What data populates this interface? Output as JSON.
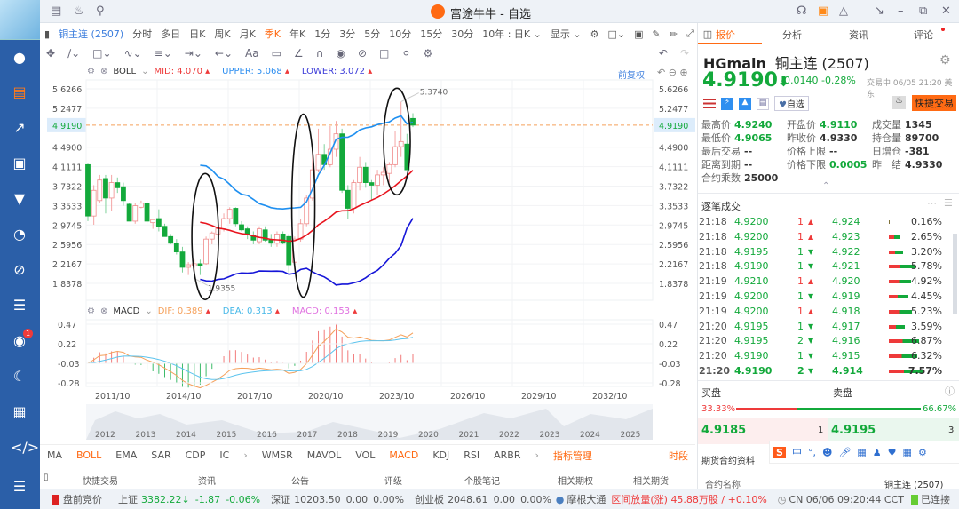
{
  "window": {
    "title": "富途牛牛 - 自选"
  },
  "toolbar": {
    "symbol": "铜主连 (2507)",
    "periods": [
      "分时",
      "多日",
      "日K",
      "周K",
      "月K",
      "季K",
      "年K",
      "1分",
      "3分",
      "5分",
      "10分",
      "15分",
      "30分"
    ],
    "active_period": "季K",
    "range": "10年 : 日K",
    "display": "显示"
  },
  "boll": {
    "name": "BOLL",
    "mid_label": "MID:",
    "mid": "4.070",
    "upper_label": "UPPER:",
    "upper": "5.068",
    "lower_label": "LOWER:",
    "lower": "3.072",
    "adjust": "前复权"
  },
  "macd": {
    "name": "MACD",
    "dif_label": "DIF:",
    "dif": "0.389",
    "dea_label": "DEA:",
    "dea": "0.313",
    "macd_label": "MACD:",
    "macd": "0.153"
  },
  "chart_data": {
    "type": "candlestick",
    "price_axis": [
      "5.6266",
      "5.2477",
      "4.9190",
      "4.4900",
      "4.1111",
      "3.7322",
      "3.3533",
      "2.9745",
      "2.5956",
      "2.2167",
      "1.8378"
    ],
    "price_range": [
      1.8378,
      5.6266
    ],
    "current_price": "4.9190",
    "high_label": "5.3740",
    "low_label": "1.9355",
    "candles": [
      [
        4.15,
        4.17,
        3.05,
        3.15
      ],
      [
        3.15,
        3.75,
        2.98,
        3.65
      ],
      [
        3.45,
        3.95,
        3.4,
        3.85
      ],
      [
        3.88,
        3.95,
        3.2,
        3.5
      ],
      [
        3.5,
        3.95,
        3.25,
        3.8
      ],
      [
        3.8,
        3.9,
        3.6,
        3.7
      ],
      [
        3.72,
        3.8,
        3.35,
        3.45
      ],
      [
        3.38,
        3.4,
        3.05,
        3.05
      ],
      [
        3.05,
        3.4,
        3.0,
        3.35
      ],
      [
        3.32,
        3.45,
        3.3,
        3.4
      ],
      [
        3.4,
        3.45,
        3.0,
        3.05
      ],
      [
        3.02,
        3.1,
        2.9,
        3.08
      ],
      [
        3.1,
        3.28,
        2.85,
        2.95
      ],
      [
        2.95,
        3.0,
        2.75,
        2.75
      ],
      [
        2.75,
        2.8,
        2.6,
        2.62
      ],
      [
        2.62,
        2.7,
        2.4,
        2.45
      ],
      [
        2.45,
        2.55,
        2.05,
        2.15
      ],
      [
        2.15,
        2.25,
        2.0,
        2.2
      ],
      [
        2.18,
        2.3,
        1.9355,
        2.22
      ],
      [
        2.22,
        2.3,
        2.0,
        2.18
      ],
      [
        2.22,
        2.75,
        2.2,
        2.7
      ],
      [
        2.7,
        2.85,
        2.6,
        2.82
      ],
      [
        2.8,
        2.9,
        2.7,
        2.9
      ],
      [
        2.9,
        3.2,
        2.85,
        3.1
      ],
      [
        3.1,
        3.32,
        3.0,
        3.28
      ],
      [
        3.3,
        3.32,
        2.95,
        3.0
      ],
      [
        2.98,
        3.05,
        2.85,
        2.88
      ],
      [
        2.9,
        2.95,
        2.7,
        2.78
      ],
      [
        2.78,
        2.85,
        2.6,
        2.68
      ],
      [
        2.65,
        2.95,
        2.6,
        2.9
      ],
      [
        2.88,
        2.95,
        2.65,
        2.68
      ],
      [
        2.68,
        2.8,
        2.55,
        2.62
      ],
      [
        2.62,
        2.85,
        2.55,
        2.8
      ],
      [
        2.8,
        2.85,
        2.6,
        2.62
      ],
      [
        2.75,
        2.8,
        2.05,
        2.2
      ],
      [
        2.25,
        2.75,
        2.15,
        2.7
      ],
      [
        2.7,
        3.1,
        2.65,
        3.0
      ],
      [
        3.0,
        3.55,
        2.95,
        3.5
      ],
      [
        3.5,
        4.45,
        3.45,
        4.05
      ],
      [
        4.05,
        4.85,
        4.0,
        4.35
      ],
      [
        4.35,
        4.55,
        4.05,
        4.15
      ],
      [
        4.15,
        4.9,
        4.1,
        4.45
      ],
      [
        4.45,
        5.0,
        4.3,
        4.75
      ],
      [
        4.75,
        4.85,
        3.6,
        3.65
      ],
      [
        3.65,
        3.75,
        3.1,
        3.3
      ],
      [
        3.3,
        3.85,
        3.2,
        3.8
      ],
      [
        3.8,
        4.3,
        3.65,
        4.1
      ],
      [
        4.1,
        4.2,
        3.7,
        3.8
      ],
      [
        3.8,
        3.85,
        3.45,
        3.75
      ],
      [
        3.75,
        4.05,
        3.55,
        3.95
      ],
      [
        3.95,
        4.1,
        3.75,
        4.0
      ],
      [
        3.98,
        4.2,
        3.8,
        4.15
      ],
      [
        4.15,
        4.8,
        4.1,
        4.5
      ],
      [
        4.5,
        5.374,
        4.3,
        4.6
      ],
      [
        4.55,
        4.75,
        4.05,
        4.05
      ],
      [
        5.05,
        5.15,
        4.88,
        4.919
      ]
    ],
    "macd_axis": [
      "0.47",
      "0.22",
      "-0.03",
      "-0.28"
    ],
    "macd_range": [
      -0.28,
      0.47
    ],
    "date_ticks": [
      "2011/10",
      "2014/10",
      "2017/10",
      "2020/10",
      "2023/10",
      "2026/10",
      "2029/10",
      "2032/10"
    ],
    "navigator_years": [
      "2012",
      "2013",
      "2014",
      "2015",
      "2016",
      "2017",
      "2018",
      "2019",
      "2020",
      "2021",
      "2022",
      "2023",
      "2024",
      "2025"
    ]
  },
  "indicators": {
    "main": [
      "MA",
      "BOLL",
      "EMA",
      "SAR",
      "CDP",
      "IC"
    ],
    "sub": [
      "WMSR",
      "MAVOL",
      "VOL",
      "MACD",
      "KDJ",
      "RSI",
      "ARBR"
    ],
    "manage": "指标管理",
    "session": "时段"
  },
  "bottom_tabs": [
    "快捷交易",
    "资讯",
    "公告",
    "评级",
    "个股笔记",
    "相关期权",
    "相关期货"
  ],
  "right": {
    "tabs": [
      "报价",
      "分析",
      "资讯",
      "评论"
    ],
    "code": "HGmain",
    "name": "铜主连 (2507)",
    "price": "4.9190",
    "change": "-0.0140",
    "change_pct": "-0.28%",
    "status": "交易中 06/05 21:20 美东",
    "watch": "自选",
    "quick_trade": "快捷交易",
    "stats": [
      [
        "最高价",
        "4.9240",
        "g"
      ],
      [
        "开盘价",
        "4.9110",
        "g"
      ],
      [
        "成交量",
        "1345",
        ""
      ],
      [
        "最低价",
        "4.9065",
        "g"
      ],
      [
        "昨收价",
        "4.9330",
        ""
      ],
      [
        "持仓量",
        "89700",
        ""
      ],
      [
        "最后交易",
        "--",
        ""
      ],
      [
        "价格上限",
        "--",
        ""
      ],
      [
        "日增仓",
        "-381",
        ""
      ],
      [
        "距离到期",
        "--",
        ""
      ],
      [
        "价格下限",
        "0.0005",
        "g"
      ],
      [
        "昨　结",
        "4.9330",
        ""
      ],
      [
        "合约乘数",
        "25000",
        ""
      ]
    ],
    "ticks_title": "逐笔成交",
    "ticks": [
      [
        "21:18",
        "4.9200",
        "1",
        "up",
        "4.924",
        "0.16%",
        0.16
      ],
      [
        "21:18",
        "4.9200",
        "1",
        "up",
        "4.923",
        "2.65%",
        2.65
      ],
      [
        "21:18",
        "4.9195",
        "1",
        "down",
        "4.922",
        "3.20%",
        3.2
      ],
      [
        "21:18",
        "4.9190",
        "1",
        "down",
        "4.921",
        "5.78%",
        5.78
      ],
      [
        "21:19",
        "4.9210",
        "1",
        "up",
        "4.920",
        "4.92%",
        4.92
      ],
      [
        "21:19",
        "4.9200",
        "1",
        "down",
        "4.919",
        "4.45%",
        4.45
      ],
      [
        "21:19",
        "4.9200",
        "1",
        "up",
        "4.918",
        "5.23%",
        5.23
      ],
      [
        "21:20",
        "4.9195",
        "1",
        "down",
        "4.917",
        "3.59%",
        3.59
      ],
      [
        "21:20",
        "4.9195",
        "2",
        "down",
        "4.916",
        "6.87%",
        6.87
      ],
      [
        "21:20",
        "4.9190",
        "1",
        "down",
        "4.915",
        "6.32%",
        6.32
      ],
      [
        "21:20",
        "4.9190",
        "2",
        "down",
        "4.914",
        "7.57%",
        7.57
      ]
    ],
    "bid_label": "买盘",
    "ask_label": "卖盘",
    "bid_pct": "33.33%",
    "ask_pct": "66.67%",
    "bid_ratio": 33.33,
    "bid": "4.9185",
    "bid_qty": "1",
    "ask": "4.9195",
    "ask_qty": "3",
    "contract_title": "期货合约资料",
    "contract_name_label": "合约名称",
    "contract_name": "铜主连 (2507)"
  },
  "ime": {
    "label": "中"
  },
  "status": {
    "market": "盘前竞价",
    "sh_label": "上证",
    "sh": "3382.22",
    "sh_chg": "-1.87",
    "sh_pct": "-0.06%",
    "sz_label": "深证",
    "sz": "10203.50",
    "sz_chg": "0.00",
    "sz_pct": "0.00%",
    "cy_label": "创业板",
    "cy": "2048.61",
    "cy_chg": "0.00",
    "cy_pct": "0.00%",
    "broker": "摩根大通",
    "flow": "区间放量(涨) 45.88万股 / +0.10%",
    "clock": "CN 06/06 09:20:44 CCT",
    "conn": "已连接"
  },
  "badge": "1"
}
